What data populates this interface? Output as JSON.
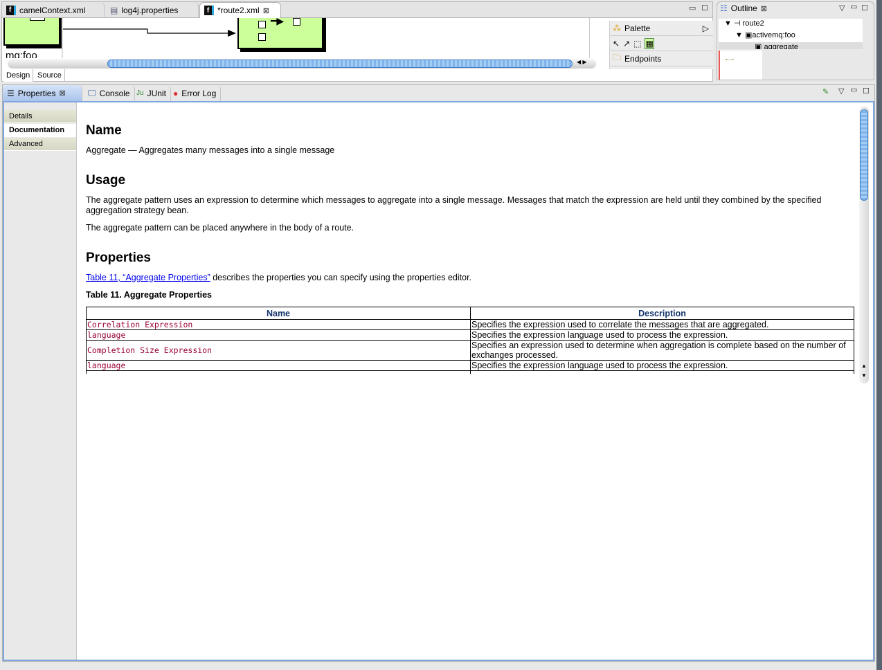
{
  "editor": {
    "tabs": [
      {
        "label": "camelContext.xml",
        "icon": "fuse-icon"
      },
      {
        "label": "log4j.properties",
        "icon": "file-icon"
      },
      {
        "label": "*route2.xml",
        "icon": "fuse-icon"
      }
    ],
    "node_label": "mq:foo",
    "bottom_tabs": [
      "Design",
      "Source"
    ],
    "palette": {
      "title": "Palette",
      "drawer": "Endpoints"
    }
  },
  "outline": {
    "title": "Outline",
    "items": [
      "route2",
      "activemq:foo",
      "aggregate"
    ]
  },
  "views": {
    "tabs": [
      "Properties",
      "Console",
      "JUnit",
      "Error Log"
    ]
  },
  "properties": {
    "side_tabs": [
      "Details",
      "Documentation",
      "Advanced"
    ],
    "selected": "Documentation"
  },
  "doc": {
    "h_name": "Name",
    "name_text": "Aggregate — Aggregates many messages into a single message",
    "h_usage": "Usage",
    "usage_p1": "The aggregate pattern uses an expression to determine which messages to aggregate into a single message. Messages that match the expression are held until they combined by the specified aggregation strategy bean.",
    "usage_p2": "The aggregate pattern can be placed anywhere in the body of a route.",
    "h_props": "Properties",
    "link": "Table 11, “Aggregate Properties”",
    "link_after": " describes the properties you can specify using the properties editor.",
    "table_title": "Table 11. Aggregate Properties",
    "table": {
      "headers": [
        "Name",
        "Description"
      ],
      "rows": [
        [
          "Correlation Expression",
          "Specifies the expression used to correlate the messages that are aggregated."
        ],
        [
          "language",
          "Specifies the expression language used to process the expression."
        ],
        [
          "Completion Size Expression",
          "Specifies an expression used to determine when aggregation is complete based on the number of exchanges processed."
        ],
        [
          "language",
          "Specifies the expression language used to process the expression."
        ]
      ]
    }
  }
}
